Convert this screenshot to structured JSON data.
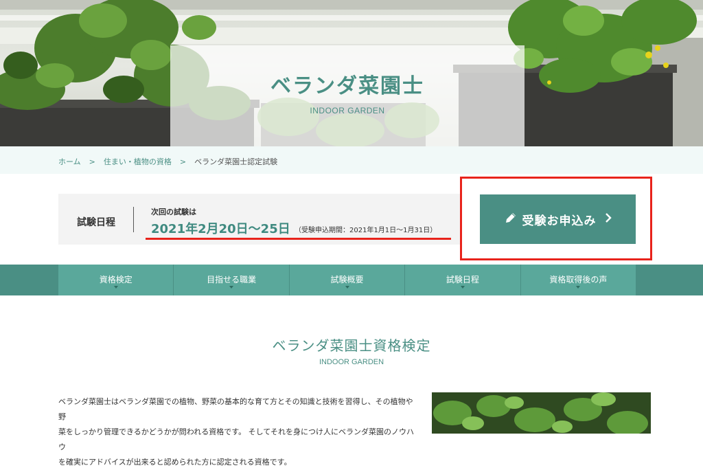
{
  "hero": {
    "title": "ベランダ菜園士",
    "subtitle": "INDOOR GARDEN"
  },
  "breadcrumb": {
    "items": [
      "ホーム",
      "住まい・植物の資格",
      "ベランダ菜園士認定試験"
    ],
    "separator": ">"
  },
  "schedule": {
    "label": "試験日程",
    "next_label": "次回の試験は",
    "date": "2021年2月20日〜25日",
    "period": "（受験申込期間：2021年1月1日〜1月31日）"
  },
  "apply": {
    "label": "受験お申込み",
    "icon": "pencil-icon",
    "chevron": "chevron-right-icon"
  },
  "nav": {
    "items": [
      {
        "label": "資格検定"
      },
      {
        "label": "目指せる職業"
      },
      {
        "label": "試験概要"
      },
      {
        "label": "試験日程"
      },
      {
        "label": "資格取得後の声"
      }
    ]
  },
  "section": {
    "title": "ベランダ菜園士資格検定",
    "subtitle": "INDOOR GARDEN",
    "paragraph_lines": [
      "ベランダ菜園士はベランダ菜園での植物、野菜の基本的な育て方とその知識と技術を習得し、その植物や野",
      "菜をしっかり管理できるかどうかが問われる資格です。 そしてそれを身につけ人にベランダ菜園のノウハウ",
      "を確実にアドバイスが出来ると認められた方に認定される資格です。"
    ]
  },
  "colors": {
    "accent": "#4a8f84",
    "nav_tab": "#5aa89b",
    "highlight": "#e8231b",
    "breadcrumb_bg": "#f1f9f8"
  }
}
